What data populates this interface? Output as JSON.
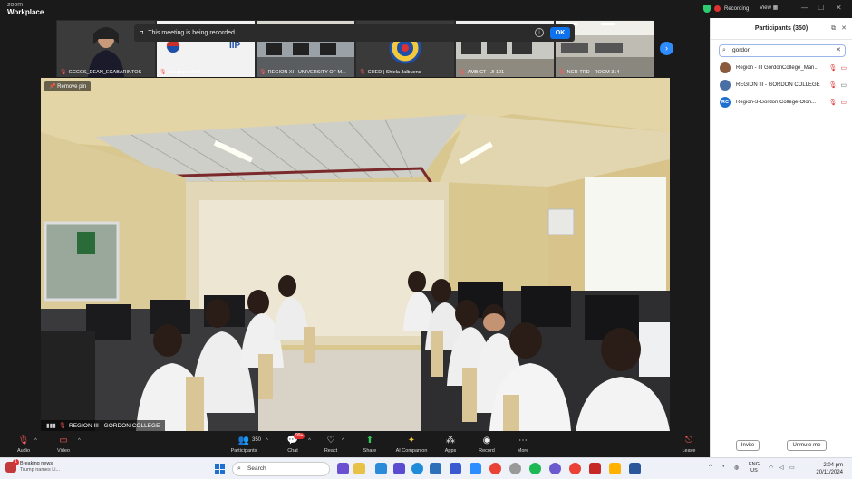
{
  "app": {
    "brand_line1": "zoom",
    "brand_line2": "Workplace"
  },
  "titlebar": {
    "recording": "Recording",
    "view": "View"
  },
  "banner": {
    "text": "This meeting is being recorded.",
    "ok": "OK"
  },
  "thumbnails": [
    {
      "name": "GCCCS_DEAN_ECABARINTOS"
    },
    {
      "name": "Janghoon Park"
    },
    {
      "name": "REGION XI - UNIVERSITY OF M..."
    },
    {
      "name": "CHED | Shiela Jalbuena"
    },
    {
      "name": "AMBICT - JI 101"
    },
    {
      "name": "NCR-TRD - ROOM 314"
    }
  ],
  "main_video": {
    "remove_pin": "Remove pin",
    "label": "REGION III - GORDON COLLEGE"
  },
  "participants_panel": {
    "title": "Participants (350)",
    "search_value": "gordon",
    "items": [
      {
        "initials": "",
        "name": "Region - III GordonCollege_Man...",
        "avatar_color": "#8a5a3c"
      },
      {
        "initials": "",
        "name": "REGION III - GORDON COLLEGE",
        "avatar_color": "#4a6fa5"
      },
      {
        "initials": "RC",
        "name": "Region-3-Gordon College-Olon...",
        "avatar_color": "#1f6fd1"
      }
    ],
    "invite": "Invite",
    "unmute_me": "Unmute me"
  },
  "toolbar": {
    "audio": "Audio",
    "video": "Video",
    "participants": "Participants",
    "participants_count": "350",
    "chat": "Chat",
    "chat_badge": "99+",
    "react": "React",
    "share": "Share",
    "ai_companion": "AI Companion",
    "apps": "Apps",
    "record": "Record",
    "more": "More",
    "leave": "Leave"
  },
  "taskbar": {
    "news_title": "Breaking news",
    "news_sub": "Trump names Li...",
    "news_badge": "1",
    "search_placeholder": "Search",
    "lang_line1": "ENG",
    "lang_line2": "US",
    "time": "2:04 pm",
    "date": "20/11/2024"
  },
  "colors": {
    "accent": "#0e72ed",
    "recording": "#e03131",
    "panel_bg": "#ffffff",
    "toolbar_bg": "#1a1a1a"
  }
}
